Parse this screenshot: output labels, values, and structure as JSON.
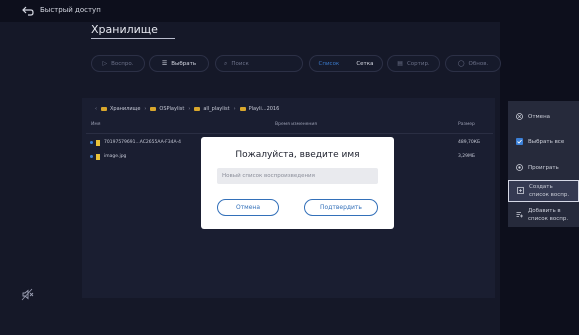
{
  "topbar": {
    "title": "Быстрый доступ"
  },
  "main": {
    "heading": "Хранилище",
    "toolbar": {
      "play": "Воспро.",
      "select": "Выбрать",
      "search_placeholder": "Поиск",
      "view_list": "Список",
      "view_grid": "Сетка",
      "sort": "Сортир.",
      "refresh": "Обнов."
    },
    "breadcrumb": [
      "Хранилище",
      "OSPlaylist",
      "all_playlist",
      "Playli...2016"
    ],
    "columns": {
      "name": "Имя",
      "time": "Время изменения",
      "size": "Размер"
    },
    "files": [
      {
        "name": "70197579691...AC2655AA-F34A-4",
        "size": "489,70КБ"
      },
      {
        "name": "image.jpg",
        "size": "3,29МБ"
      }
    ]
  },
  "side_panel": {
    "cancel": "Отмена",
    "select_all": "Выбрать все",
    "play": "Проиграть",
    "create_line1": "Создать",
    "create_line2": "список воспр.",
    "add_line1": "Добавить в",
    "add_line2": "список воспр."
  },
  "dialog": {
    "title": "Пожалуйста, введите имя",
    "input_placeholder": "Новый список воспроизведения",
    "cancel": "Отмена",
    "confirm": "Подтвердить"
  },
  "colors": {
    "accent": "#3370b9",
    "folder": "#d9a72c",
    "background": "#0d0f1c"
  }
}
